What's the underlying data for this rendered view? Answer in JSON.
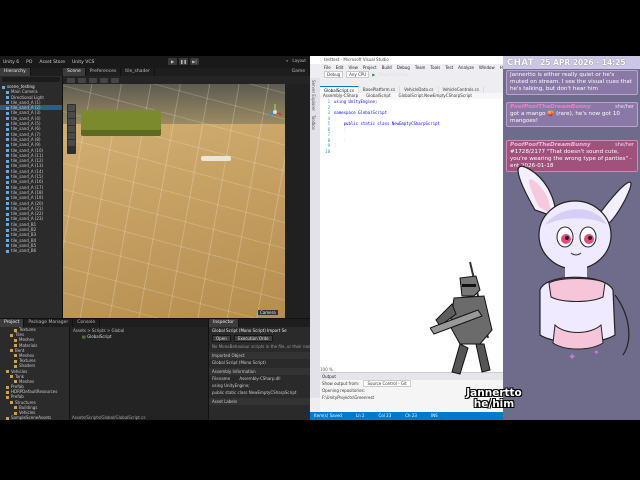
{
  "unity": {
    "menubar": [
      "Unity 6",
      "PO",
      "Asset Store",
      "Unity VCS"
    ],
    "layout_label": "Layout",
    "hierarchy_tab": "Hierarchy",
    "scene_tabs": [
      "Scene",
      "Preferences",
      "tile_shader",
      "Game"
    ],
    "hierarchy_items": [
      "scene_testing",
      "Main Camera",
      "Directional Light",
      "tile_sand_A (1)",
      "tile_sand_A (2)",
      "tile_sand_A (3)",
      "tile_sand_A (4)",
      "tile_sand_A (5)",
      "tile_sand_A (6)",
      "tile_sand_A (7)",
      "tile_sand_A (8)",
      "tile_sand_A (9)",
      "tile_sand_A (10)",
      "tile_sand_A (11)",
      "tile_sand_A (12)",
      "tile_sand_A (13)",
      "tile_sand_A (14)",
      "tile_sand_A (15)",
      "tile_sand_A (16)",
      "tile_sand_A (17)",
      "tile_sand_A (18)",
      "tile_sand_A (19)",
      "tile_sand_A (20)",
      "tile_sand_A (21)",
      "tile_sand_A (22)",
      "tile_sand_A (23)",
      "tile_sand_B1",
      "tile_sand_B2",
      "tile_sand_B3",
      "tile_sand_B4",
      "tile_sand_B5",
      "tile_sand_B6"
    ],
    "camera_label": "Camera",
    "bottom_tabs": [
      "Project",
      "Package Manager",
      "Console"
    ],
    "project_items": [
      "Textures",
      "Tiles",
      "Meshes",
      "Materials",
      "Bent",
      "Meshes",
      "Textures",
      "Shaders",
      "Vehicles",
      "Tank",
      "Meshes",
      "Prefab",
      "HDRPDefaultResources",
      "Prefab",
      "Structures",
      "Buildings",
      "Vehicles",
      "SampleSceneAssets",
      "Scenes",
      "Scripts",
      "Control",
      "Global",
      "Structures",
      "TileMap"
    ],
    "asset_breadcrumb": "Assets > Scripts > Global",
    "asset_file": "GlobalScript",
    "asset_path": "Assets/Scripts/Global/GlobalScript.cs",
    "inspector": {
      "tab": "Inspector",
      "title": "Global Script (Mono Script) Import Se",
      "buttons": [
        "Open",
        "Execution Orde"
      ],
      "note": "No MonoBehaviour scripts in the file, or their names",
      "imported_object": "Imported Object",
      "object_name": "Global Script (Mono Script)",
      "assembly_info": "Assembly Information",
      "filename_label": "Filename",
      "filename_value": "Assembly-CSharp.dll",
      "using_line": "using UnityEngine;",
      "class_line": "public static class NewEmptyCSharpScript",
      "asset_labels": "Asset Labels"
    }
  },
  "vs": {
    "title": "testtest - Microsoft Visual Studio",
    "menu": [
      "File",
      "Edit",
      "View",
      "Project",
      "Build",
      "Debug",
      "Team",
      "Tools",
      "Test",
      "Analyze",
      "Window",
      "Help"
    ],
    "config": "Debug",
    "platform": "Any CPU",
    "attach": "Attach to Unity",
    "side_tabs": [
      "Server Explorer",
      "Toolbox"
    ],
    "tabs": [
      "GlobalScript.cs",
      "BasePlatform.cs",
      "VehicleData.cs",
      "VehicleControls.cs"
    ],
    "nav_left": "Assembly-CSharp",
    "nav_mid": "GlobalScript",
    "nav_right": "GlobalScript.NewEmptyCSharpScript",
    "code": [
      {
        "n": "1",
        "t": "using UnityEngine;"
      },
      {
        "n": "2",
        "t": ""
      },
      {
        "n": "3",
        "t": "namespace GlobalScript"
      },
      {
        "n": "4",
        "t": "{"
      },
      {
        "n": "5",
        "t": "    public static class NewEmptyCSharpScript"
      },
      {
        "n": "6",
        "t": "    {"
      },
      {
        "n": "7",
        "t": ""
      },
      {
        "n": "8",
        "t": "    }"
      },
      {
        "n": "9",
        "t": "}"
      },
      {
        "n": "10",
        "t": ""
      }
    ],
    "zoom": "100 %",
    "output_title": "Output",
    "output_from_label": "Show output from:",
    "output_from_value": "Source Control - Git",
    "output_lines": [
      "Opening repositories:",
      "F:\\UnityProjects\\Greenrest"
    ],
    "status": [
      "Item(s) Saved",
      "Ln 2",
      "Col 23",
      "Ch 23",
      "INS"
    ]
  },
  "chat": {
    "header_word": "CHAT",
    "date": "25 APR 2026 · 14:25",
    "messages": [
      {
        "name": "",
        "pronouns": "",
        "text": "Jannertto is either really quiet or he's muted on stream. I see the visual cues that he's talking, but don't hear him"
      },
      {
        "name": "PoofPoofTheDreamBunny",
        "pronouns": "she/her",
        "text": "got a mango 🍑 (rare), he's now got 10 mangoes!"
      },
      {
        "name": "PoofPoofTheDreamBunny",
        "pronouns": "she/her",
        "text": "#1728/2177 \"That doesn't sound cute, you're wearing the wrong type of panties\" - ent 2026-01-18"
      }
    ]
  },
  "streamer": {
    "name": "Jannertto",
    "pronouns": "he/him"
  }
}
